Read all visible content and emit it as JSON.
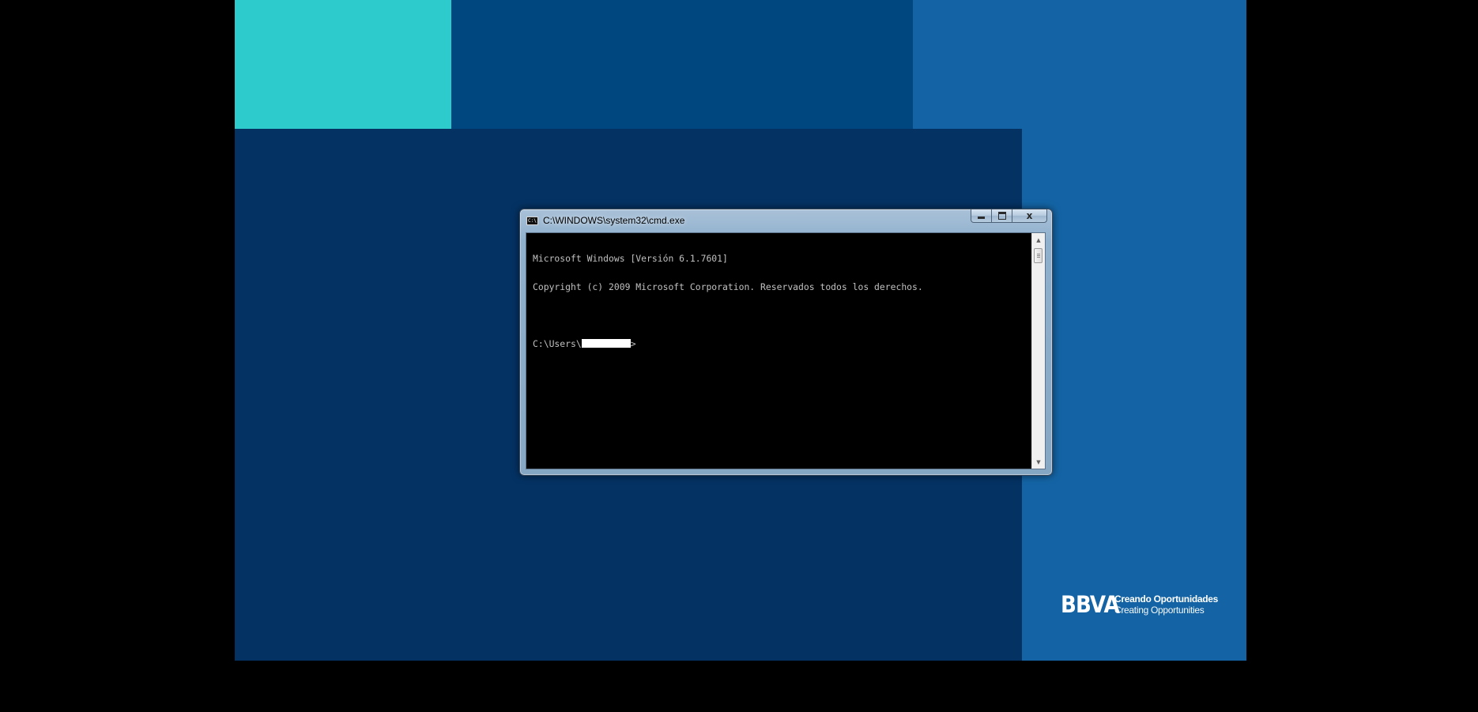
{
  "desktop": {
    "colors": {
      "background": "#000000",
      "teal": "#2ecbcc",
      "blue_mid": "#00467f",
      "blue_dark": "#043263",
      "blue_light": "#1464a5"
    },
    "logo": {
      "mark": "BBVA",
      "tagline_es": "Creando Oportunidades",
      "tagline_en": "Creating Opportunities"
    }
  },
  "window": {
    "title": "C:\\WINDOWS\\system32\\cmd.exe",
    "icon": "console-app-icon",
    "icon_text": "C:\\",
    "buttons": {
      "minimize": "minimize-icon",
      "maximize": "maximize-icon",
      "close": "x"
    }
  },
  "console": {
    "line1": "Microsoft Windows [Versión 6.1.7601]",
    "line2": "Copyright (c) 2009 Microsoft Corporation. Reservados todos los derechos.",
    "prompt_prefix": "C:\\Users\\",
    "prompt_suffix": ">",
    "text_color": "#c0c0c0"
  },
  "scrollbar": {
    "up_glyph": "▲",
    "down_glyph": "▼"
  }
}
